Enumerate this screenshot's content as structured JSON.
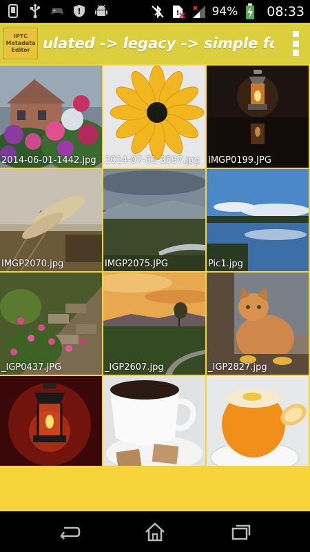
{
  "status_bar": {
    "battery_percent": "94%",
    "time": "08:33",
    "left_icons": [
      "phone-icon",
      "usb-icon",
      "game-controller-icon",
      "shield-icon",
      "android-icon"
    ],
    "right_icons": [
      "bluetooth-muted-icon",
      "sim-alert-icon",
      "signal-icon",
      "battery-charging-icon"
    ]
  },
  "action_bar": {
    "logo_lines": [
      "IPTC",
      "Metadata",
      "Editor"
    ],
    "breadcrumb": "ulated ->  legacy ->  simple folder ->",
    "overflow_icon": "overflow-menu-icon"
  },
  "grid": {
    "items": [
      {
        "caption": "2014-06-01-1442.jpg"
      },
      {
        "caption": "2014-07-31-3597.jpg"
      },
      {
        "caption": "IMGP0199.JPG"
      },
      {
        "caption": "IMGP2070.jpg"
      },
      {
        "caption": "IMGP2075.JPG"
      },
      {
        "caption": "Pic1.jpg"
      },
      {
        "caption": "_IGP0437.JPG"
      },
      {
        "caption": "_IGP2607.jpg"
      },
      {
        "caption": "_IGP2827.jpg"
      },
      {
        "caption": ""
      },
      {
        "caption": ""
      },
      {
        "caption": ""
      }
    ]
  },
  "nav_bar": {
    "icons": [
      "back-icon",
      "home-icon",
      "recent-apps-icon"
    ]
  },
  "colors": {
    "action_bar": "#dbcf3e",
    "grid_background": "#f6d43a"
  }
}
